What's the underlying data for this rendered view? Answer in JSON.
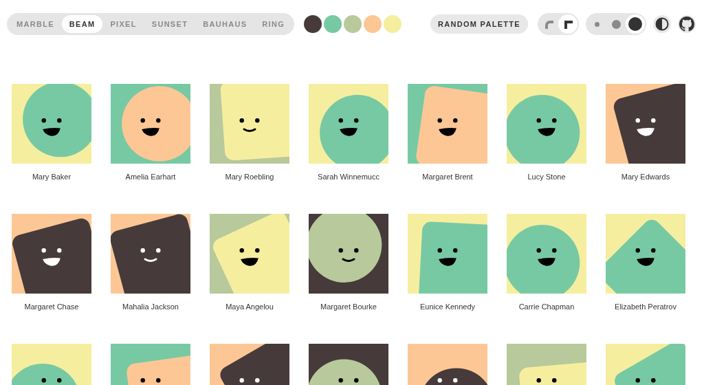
{
  "variants": [
    {
      "label": "MARBLE",
      "selected": false
    },
    {
      "label": "BEAM",
      "selected": true
    },
    {
      "label": "PIXEL",
      "selected": false
    },
    {
      "label": "SUNSET",
      "selected": false
    },
    {
      "label": "BAUHAUS",
      "selected": false
    },
    {
      "label": "RING",
      "selected": false
    }
  ],
  "palette": [
    {
      "color": "#463a3b"
    },
    {
      "color": "#77c9a4"
    },
    {
      "color": "#b8c99b"
    },
    {
      "color": "#fcc795"
    },
    {
      "color": "#f6ee9f"
    }
  ],
  "random_button": "RANDOM PALETTE",
  "shape_toggle": [
    {
      "kind": "round",
      "selected": false
    },
    {
      "kind": "square",
      "selected": true
    }
  ],
  "size_toggle": [
    {
      "kind": "small",
      "selected": false
    },
    {
      "kind": "medium",
      "selected": false
    },
    {
      "kind": "large",
      "selected": true
    }
  ],
  "avatars": [
    {
      "name": "Mary Baker",
      "kind": "circle"
    },
    {
      "name": "Amelia Earhart",
      "kind": "circle"
    },
    {
      "name": "Mary Roebling",
      "kind": "square"
    },
    {
      "name": "Sarah Winnemucc",
      "kind": "circle"
    },
    {
      "name": "Margaret Brent",
      "kind": "square"
    },
    {
      "name": "Lucy Stone",
      "kind": "circle"
    },
    {
      "name": "Mary Edwards",
      "kind": "square"
    },
    {
      "name": "Margaret Chase",
      "kind": "square"
    },
    {
      "name": "Mahalia Jackson",
      "kind": "square"
    },
    {
      "name": "Maya Angelou",
      "kind": "square"
    },
    {
      "name": "Margaret Bourke",
      "kind": "circle"
    },
    {
      "name": "Eunice Kennedy",
      "kind": "square"
    },
    {
      "name": "Carrie Chapman",
      "kind": "circle"
    },
    {
      "name": "Elizabeth Peratrov",
      "kind": "square"
    },
    {
      "kind": "circle"
    },
    {
      "kind": "square"
    },
    {
      "kind": "square"
    },
    {
      "kind": "circle"
    },
    {
      "kind": "circle"
    },
    {
      "kind": "square"
    },
    {
      "kind": "square"
    }
  ]
}
